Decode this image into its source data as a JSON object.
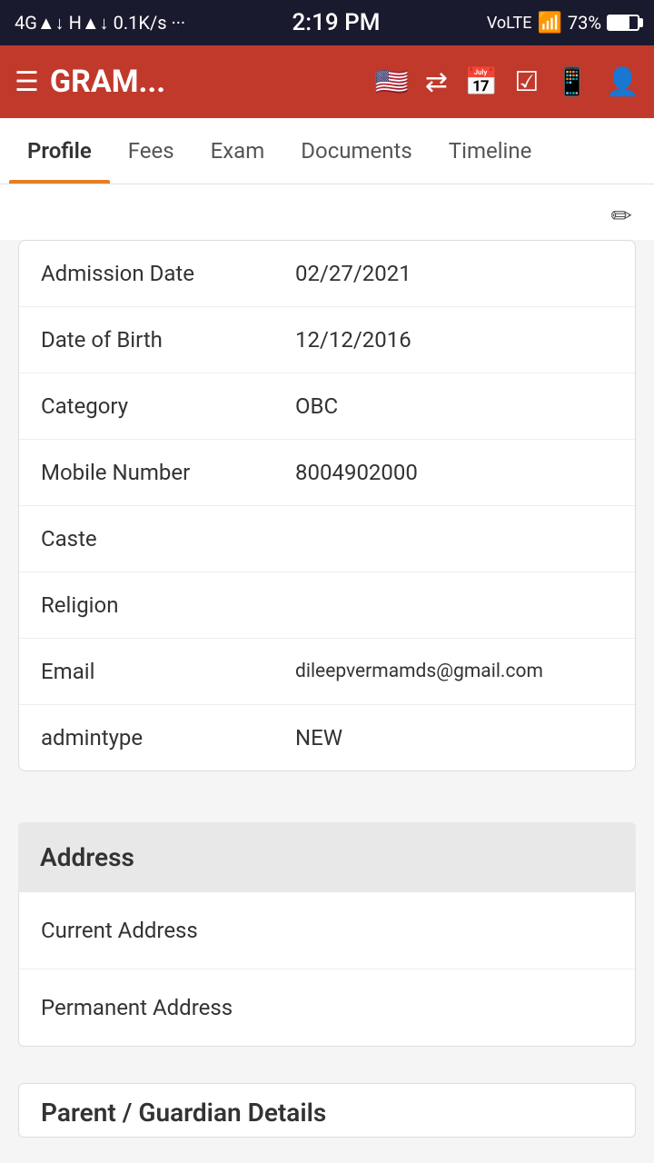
{
  "statusBar": {
    "left": "4G ▲↓ H ▲↓ 0.1K/s ···",
    "time": "2:19 PM",
    "right": "VoLTE  WiFi  73%"
  },
  "navbar": {
    "menuIcon": "☰",
    "title": "GRAM...",
    "icons": [
      "🇺🇸",
      "⇄",
      "📅",
      "✓",
      "📞",
      "👤"
    ]
  },
  "tabs": [
    {
      "label": "Profile",
      "active": true
    },
    {
      "label": "Fees",
      "active": false
    },
    {
      "label": "Exam",
      "active": false
    },
    {
      "label": "Documents",
      "active": false
    },
    {
      "label": "Timeline",
      "active": false
    }
  ],
  "editIcon": "✏",
  "profileInfo": {
    "rows": [
      {
        "label": "Admission Date",
        "value": "02/27/2021"
      },
      {
        "label": "Date of Birth",
        "value": "12/12/2016"
      },
      {
        "label": "Category",
        "value": "OBC"
      },
      {
        "label": "Mobile Number",
        "value": "8004902000"
      },
      {
        "label": "Caste",
        "value": ""
      },
      {
        "label": "Religion",
        "value": ""
      },
      {
        "label": "Email",
        "value": "dileepvermamds@gmail.com"
      },
      {
        "label": "admintype",
        "value": "NEW"
      }
    ]
  },
  "address": {
    "sectionTitle": "Address",
    "rows": [
      {
        "label": "Current Address"
      },
      {
        "label": "Permanent Address"
      }
    ]
  },
  "parentSection": {
    "title": "Parent / Guardian Details"
  }
}
